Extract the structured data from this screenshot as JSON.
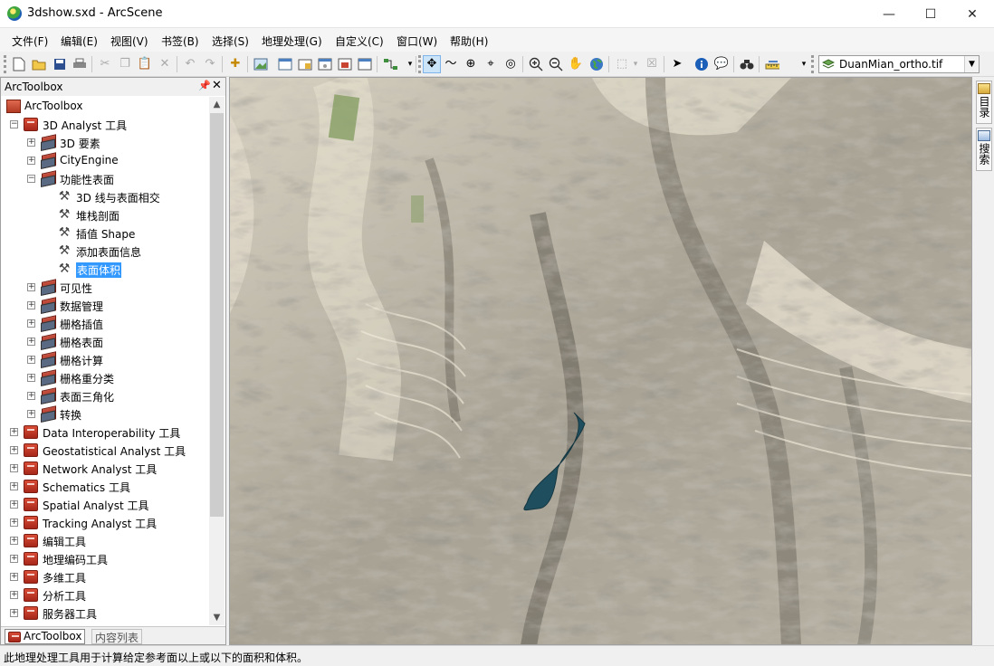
{
  "window": {
    "title": "3dshow.sxd - ArcScene",
    "minimize": "—",
    "maximize": "☐",
    "close": "✕"
  },
  "menu": [
    "文件(F)",
    "编辑(E)",
    "视图(V)",
    "书签(B)",
    "选择(S)",
    "地理处理(G)",
    "自定义(C)",
    "窗口(W)",
    "帮助(H)"
  ],
  "toolbar": {
    "layer_select": "DuanMian_ortho.tif"
  },
  "panel": {
    "title": "ArcToolbox",
    "pin": "📌",
    "close": "✕",
    "tree": [
      {
        "label": "ArcToolbox"
      },
      {
        "label": "3D Analyst 工具",
        "expander": "−"
      },
      {
        "label": "3D 要素",
        "expander": "+"
      },
      {
        "label": "CityEngine",
        "expander": "+"
      },
      {
        "label": "功能性表面",
        "expander": "−"
      },
      {
        "label": "3D 线与表面相交"
      },
      {
        "label": "堆栈剖面"
      },
      {
        "label": "插值 Shape"
      },
      {
        "label": "添加表面信息"
      },
      {
        "label": "表面体积",
        "selected": true
      },
      {
        "label": "可见性",
        "expander": "+"
      },
      {
        "label": "数据管理",
        "expander": "+"
      },
      {
        "label": "栅格插值",
        "expander": "+"
      },
      {
        "label": "栅格表面",
        "expander": "+"
      },
      {
        "label": "栅格计算",
        "expander": "+"
      },
      {
        "label": "栅格重分类",
        "expander": "+"
      },
      {
        "label": "表面三角化",
        "expander": "+"
      },
      {
        "label": "转换",
        "expander": "+"
      },
      {
        "label": "Data Interoperability 工具",
        "expander": "+"
      },
      {
        "label": "Geostatistical Analyst 工具",
        "expander": "+"
      },
      {
        "label": "Network Analyst 工具",
        "expander": "+"
      },
      {
        "label": "Schematics 工具",
        "expander": "+"
      },
      {
        "label": "Spatial Analyst 工具",
        "expander": "+"
      },
      {
        "label": "Tracking Analyst 工具",
        "expander": "+"
      },
      {
        "label": "编辑工具",
        "expander": "+"
      },
      {
        "label": "地理编码工具",
        "expander": "+"
      },
      {
        "label": "多维工具",
        "expander": "+"
      },
      {
        "label": "分析工具",
        "expander": "+"
      },
      {
        "label": "服务器工具",
        "expander": "+"
      }
    ],
    "tabs": {
      "toolbox": "ArcToolbox",
      "toc": "内容列表"
    }
  },
  "right_tabs": {
    "catalog": "目录",
    "search": "搜索"
  },
  "status": "此地理处理工具用于计算给定参考面以上或以下的面积和体积。",
  "icons": {
    "new": "new-document-icon",
    "open": "open-folder-icon",
    "save": "save-icon",
    "print": "print-icon",
    "cut": "cut-icon",
    "copy": "copy-icon",
    "paste": "paste-icon",
    "delete": "delete-icon",
    "undo": "undo-icon",
    "redo": "redo-icon",
    "add_data": "add-data-icon"
  }
}
